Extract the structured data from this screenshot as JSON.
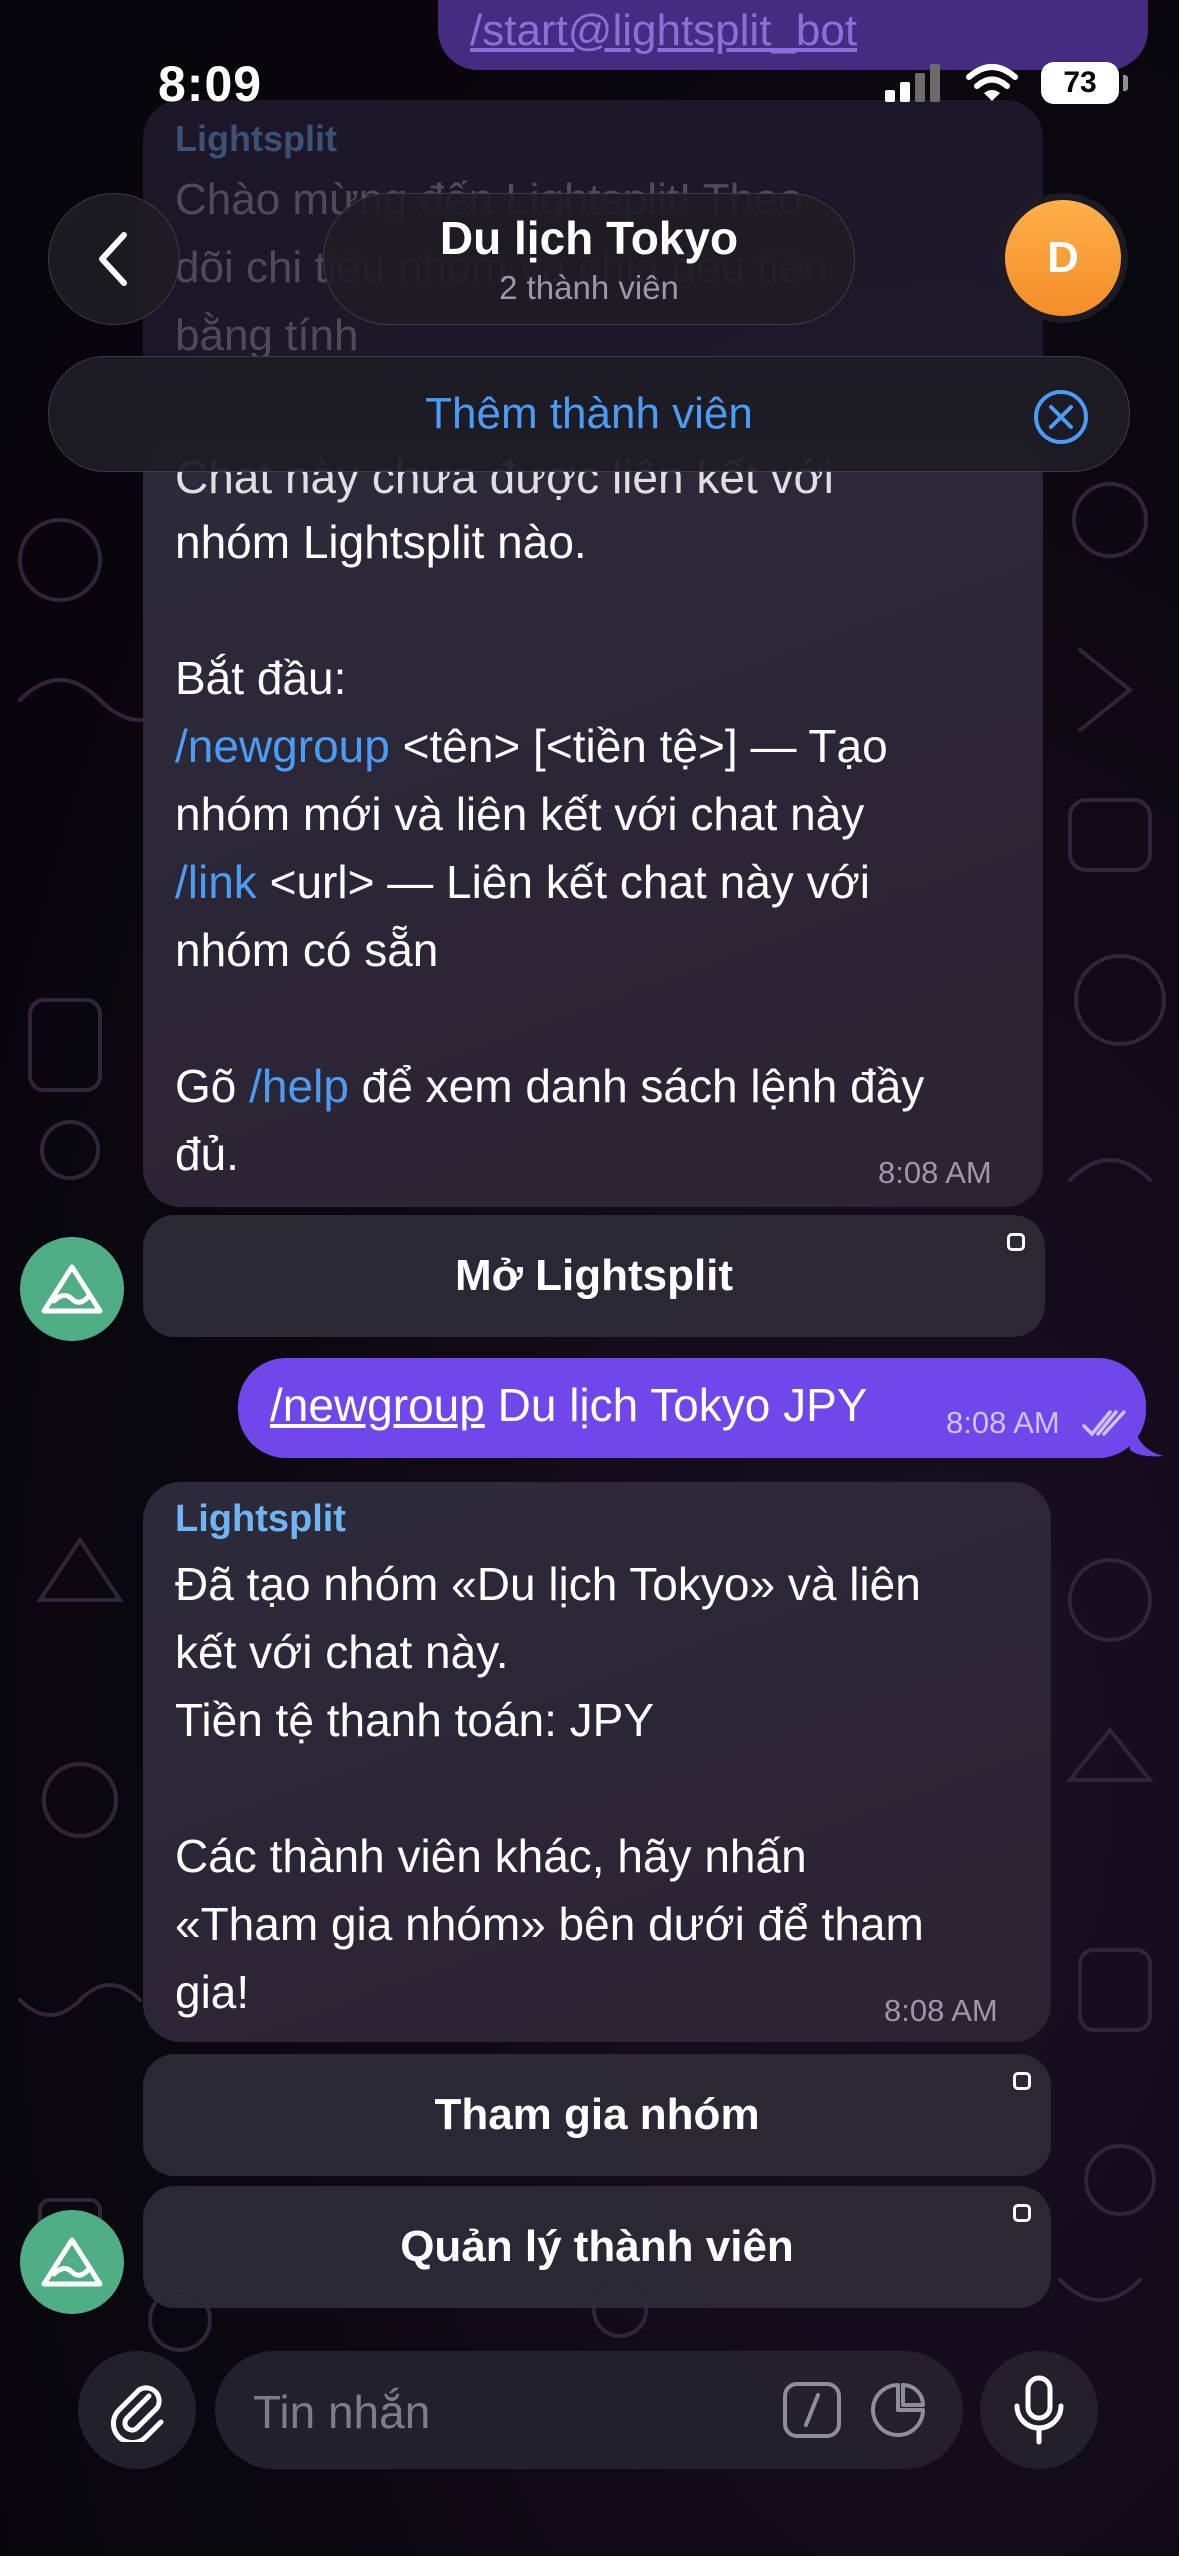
{
  "status_bar": {
    "time": "8:09",
    "battery": "73"
  },
  "background": {
    "prev_message_text": "/start@lightsplit_bot",
    "prev_sender": "Lightsplit",
    "prev_lines": [
      "Chào mừng đến Lightsplit! Theo",
      "dõi chi tiêu nhóm và chia đều tiền",
      "bằng tính"
    ]
  },
  "header": {
    "title": "Du lịch Tokyo",
    "subtitle": "2 thành viên",
    "avatar_letter": "D",
    "add_member_label": "Thêm thành viên"
  },
  "messages": {
    "m1": {
      "cut_line": "Chat này chưa được liên kết với",
      "line1": "nhóm Lightsplit nào.",
      "start_label": "Bắt đầu:",
      "newgroup_cmd": "/newgroup",
      "newgroup_rest": " <tên> [<tiền tệ>] — Tạo",
      "newgroup_line2": "nhóm mới và liên kết với chat này",
      "link_cmd": "/link",
      "link_rest": " <url> — Liên kết chat này với",
      "link_line2": "nhóm có sẵn",
      "help_pre": "Gõ ",
      "help_cmd": "/help",
      "help_rest": " để xem danh sách lệnh đầy",
      "help_line2": "đủ.",
      "time": "8:08 AM",
      "button": "Mở Lightsplit"
    },
    "out": {
      "cmd": "/newgroup",
      "rest": " Du lịch Tokyo JPY",
      "time": "8:08 AM"
    },
    "m2": {
      "sender": "Lightsplit",
      "lines": [
        "Đã tạo nhóm «Du lịch Tokyo» và liên",
        "kết với chat này.",
        "Tiền tệ thanh toán: JPY",
        "",
        "Các thành viên khác, hãy nhấn",
        "«Tham gia nhóm» bên dưới để tham",
        "gia!"
      ],
      "time": "8:08 AM",
      "buttons": [
        "Tham gia nhóm",
        "Quản lý thành viên"
      ]
    }
  },
  "input": {
    "placeholder": "Tin nhắn"
  },
  "colors": {
    "accent": "#4b9cf5",
    "outgoing": "#7047ea",
    "bot_avatar": "#4fae86",
    "user_avatar": "#f7a23a"
  }
}
